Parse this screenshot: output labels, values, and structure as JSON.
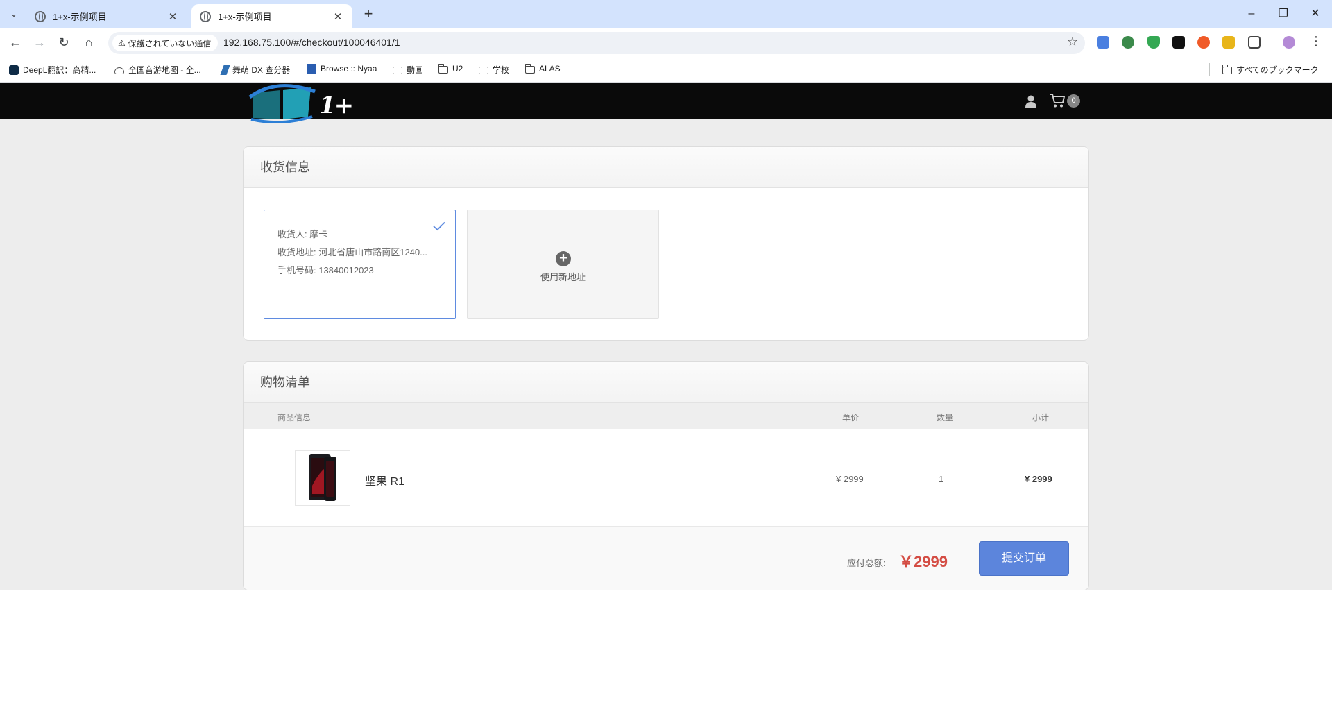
{
  "browser": {
    "tabs": [
      {
        "title": "1+x-示例项目",
        "active": false
      },
      {
        "title": "1+x-示例项目",
        "active": true
      }
    ],
    "security_label": "保護されていない通信",
    "url": "192.168.75.100/#/checkout/100046401/1",
    "bookmarks": [
      {
        "label": "DeepL翻訳：高精...",
        "icon": "deepl-icon"
      },
      {
        "label": "全国音游地图 - 全...",
        "icon": "map-icon"
      },
      {
        "label": "舞萌 DX 查分器",
        "icon": "maimai-icon"
      },
      {
        "label": "Browse :: Nyaa",
        "icon": "nyaa-icon"
      },
      {
        "label": "動画",
        "icon": "folder-icon"
      },
      {
        "label": "U2",
        "icon": "folder-icon"
      },
      {
        "label": "学校",
        "icon": "folder-icon"
      },
      {
        "label": "ALAS",
        "icon": "folder-icon"
      }
    ],
    "all_bookmarks": "すべてのブックマーク"
  },
  "site": {
    "logo_text": "1+",
    "cart_count": "0"
  },
  "address": {
    "section_title": "收货信息",
    "recipient": "收货人: 摩卡",
    "address": "收货地址: 河北省唐山市路南区1240...",
    "phone": "手机号码: 13840012023",
    "new_address_label": "使用新地址"
  },
  "cart": {
    "section_title": "购物清单",
    "columns": {
      "info": "商品信息",
      "price": "单价",
      "qty": "数量",
      "subtotal": "小计"
    },
    "items": [
      {
        "name": "坚果 R1",
        "price": "¥ 2999",
        "qty": "1",
        "subtotal": "¥ 2999"
      }
    ],
    "total_label": "应付总额:",
    "total_value": "￥2999",
    "submit_label": "提交订单"
  },
  "colors": {
    "accent": "#5c85dc",
    "price_red": "#d44d44",
    "header_bg": "#0a0a0a"
  }
}
